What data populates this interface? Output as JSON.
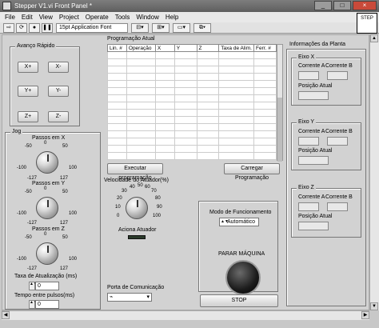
{
  "window": {
    "title": "Stepper V1.vi Front Panel *",
    "minimize": "_",
    "maximize": "□",
    "close": "×"
  },
  "menu": [
    "File",
    "Edit",
    "View",
    "Project",
    "Operate",
    "Tools",
    "Window",
    "Help"
  ],
  "toolbar": {
    "font": "15pt Application Font"
  },
  "vi_icon": "STEP",
  "avanco": {
    "title": "Avanço Rápido",
    "buttons": [
      "X+",
      "X-",
      "Y+",
      "Y-",
      "Z+",
      "Z-"
    ]
  },
  "jog": {
    "title": "Jog",
    "knobs": [
      {
        "label": "Passos em X",
        "ticks": [
          "-50",
          "0",
          "50",
          "-100",
          "100",
          "-127",
          "127"
        ],
        "level_fraction": 0.5
      },
      {
        "label": "Passos em Y",
        "ticks": [
          "-50",
          "0",
          "50",
          "-100",
          "100",
          "-127",
          "127"
        ],
        "level_fraction": 0.5
      },
      {
        "label": "Passos em Z",
        "ticks": [
          "-50",
          "0",
          "50",
          "-100",
          "100",
          "-127",
          "127"
        ],
        "level_fraction": 0.5
      }
    ],
    "taxa_label": "Taxa de Atualização (ms)",
    "taxa_value": "0",
    "tempo_label": "Tempo entre pulsos(ms)",
    "tempo_value": "0"
  },
  "programacao": {
    "title": "Programação Atual",
    "columns": [
      "Lin. #",
      "Operação",
      "X",
      "Y",
      "Z",
      "Taxa de Alim.",
      "Ferr. #"
    ],
    "executar": "Executar programação",
    "carregar": "Carregar Programação"
  },
  "atuador": {
    "label": "Velocidade do Atuador(%)",
    "ticks": [
      "30",
      "40",
      "50",
      "60",
      "70",
      "20",
      "80",
      "10",
      "90",
      "0",
      "100"
    ],
    "level_fraction": 0.5,
    "aciona_label": "Aciona Atuador"
  },
  "porta": {
    "label": "Porta de Comunicação",
    "value": ""
  },
  "modo": {
    "label": "Modo de Funcionamento",
    "value": "Automático"
  },
  "parar": {
    "label": "PARAR MÁQUINA",
    "stop": "STOP"
  },
  "planta": {
    "title": "Informações da Planta",
    "eixos": [
      {
        "name": "Eixo X",
        "corrente_a": "Corrente A",
        "corrente_b": "Corrente B",
        "posicao": "Posição Atual"
      },
      {
        "name": "Eixo Y",
        "corrente_a": "Corrente A",
        "corrente_b": "Corrente B",
        "posicao": "Posição Atual"
      },
      {
        "name": "Eixo Z",
        "corrente_a": "Corrente A",
        "corrente_b": "Corrente B",
        "posicao": "Posição Atual"
      }
    ]
  }
}
